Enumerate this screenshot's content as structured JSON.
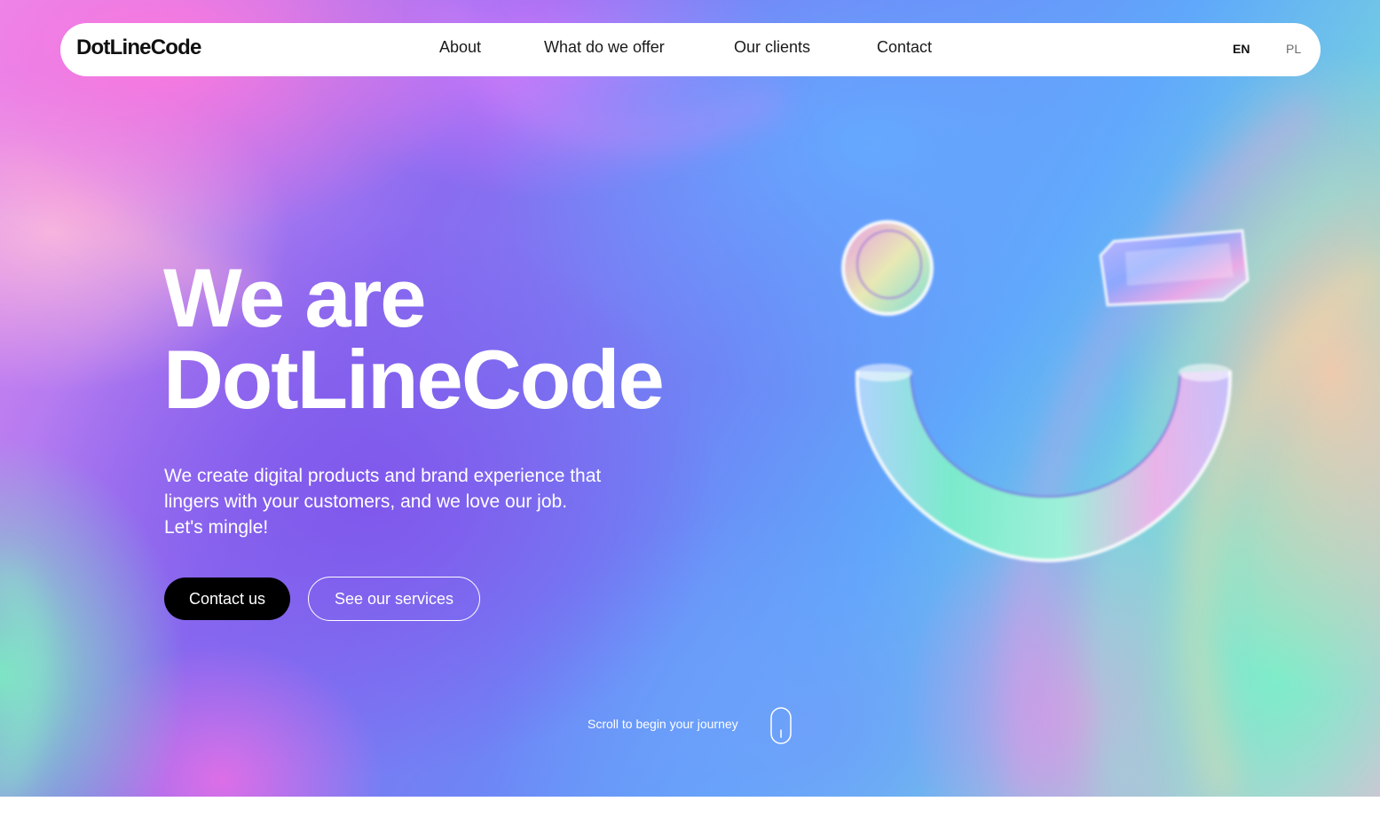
{
  "brand": {
    "logo_text": "DotLineCode"
  },
  "nav": {
    "items": [
      {
        "label": "About"
      },
      {
        "label": "What do we offer"
      },
      {
        "label": "Our clients"
      },
      {
        "label": "Contact"
      }
    ],
    "languages": [
      {
        "code": "EN",
        "active": true
      },
      {
        "code": "PL",
        "active": false
      }
    ]
  },
  "hero": {
    "headline_line1": "We are",
    "headline_line2": "DotLineCode",
    "subtext_line1": "We create digital products and brand experience that",
    "subtext_line2": "lingers with your customers, and we love our job.",
    "subtext_line3": "Let's mingle!",
    "primary_button": "Contact us",
    "secondary_button": "See our services",
    "scroll_hint": "Scroll to begin your journey"
  },
  "colors": {
    "primary_button_bg": "#000000",
    "text_on_hero": "#ffffff",
    "navbar_bg": "#ffffff"
  },
  "icons": {
    "scroll": "mouse-scroll-icon",
    "illustration": "glass-smiley-illustration"
  }
}
